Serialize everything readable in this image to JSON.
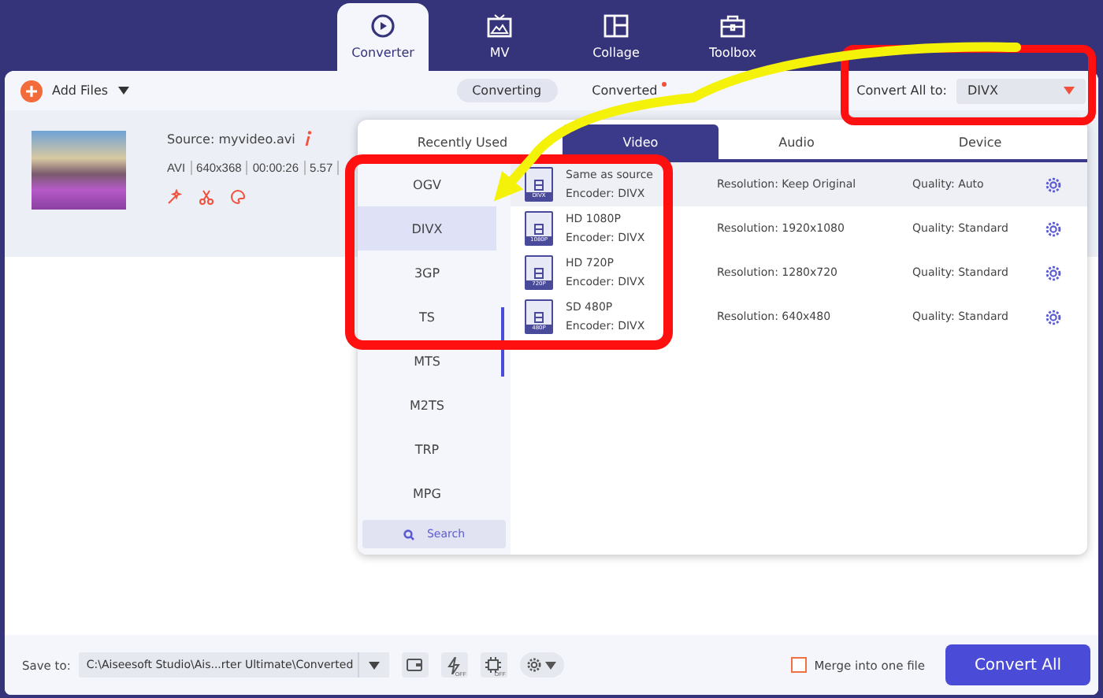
{
  "nav_tabs": [
    {
      "label": "Converter",
      "selected": true
    },
    {
      "label": "MV",
      "selected": false
    },
    {
      "label": "Collage",
      "selected": false
    },
    {
      "label": "Toolbox",
      "selected": false
    }
  ],
  "toolbar": {
    "add_files": "Add Files",
    "segments": [
      {
        "label": "Converting",
        "selected": true,
        "badge": false
      },
      {
        "label": "Converted",
        "selected": false,
        "badge": true
      }
    ],
    "convert_all_label": "Convert All to:",
    "convert_all_value": "DIVX"
  },
  "file": {
    "source": "Source: myvideo.avi",
    "info": [
      "AVI",
      "640x368",
      "00:00:26",
      "5.57"
    ]
  },
  "format_panel": {
    "tabs": [
      {
        "label": "Recently Used",
        "selected": false
      },
      {
        "label": "Video",
        "selected": true
      },
      {
        "label": "Audio",
        "selected": false
      },
      {
        "label": "Device",
        "selected": false
      }
    ],
    "formats": [
      {
        "label": "OGV",
        "selected": false
      },
      {
        "label": "DIVX",
        "selected": true
      },
      {
        "label": "3GP",
        "selected": false
      },
      {
        "label": "TS",
        "selected": false
      },
      {
        "label": "MTS",
        "selected": false
      },
      {
        "label": "M2TS",
        "selected": false
      },
      {
        "label": "TRP",
        "selected": false
      },
      {
        "label": "MPG",
        "selected": false
      }
    ],
    "search": "Search",
    "presets": [
      {
        "badge": "DIVX",
        "name": "Same as source",
        "encoder": "Encoder: DIVX",
        "resolution": "Resolution: Keep Original",
        "quality": "Quality: Auto",
        "selected": true
      },
      {
        "badge": "1080P",
        "name": "HD 1080P",
        "encoder": "Encoder: DIVX",
        "resolution": "Resolution: 1920x1080",
        "quality": "Quality: Standard",
        "selected": false
      },
      {
        "badge": "720P",
        "name": "HD 720P",
        "encoder": "Encoder: DIVX",
        "resolution": "Resolution: 1280x720",
        "quality": "Quality: Standard",
        "selected": false
      },
      {
        "badge": "480P",
        "name": "SD 480P",
        "encoder": "Encoder: DIVX",
        "resolution": "Resolution: 640x480",
        "quality": "Quality: Standard",
        "selected": false
      }
    ]
  },
  "bottom_bar": {
    "save_to_label": "Save to:",
    "save_path": "C:\\Aiseesoft Studio\\Ais...rter Ultimate\\Converted",
    "off_badges": [
      "OFF",
      "OFF"
    ],
    "merge": {
      "label": "Merge into one file",
      "checked": false
    },
    "convert_button": "Convert All"
  }
}
